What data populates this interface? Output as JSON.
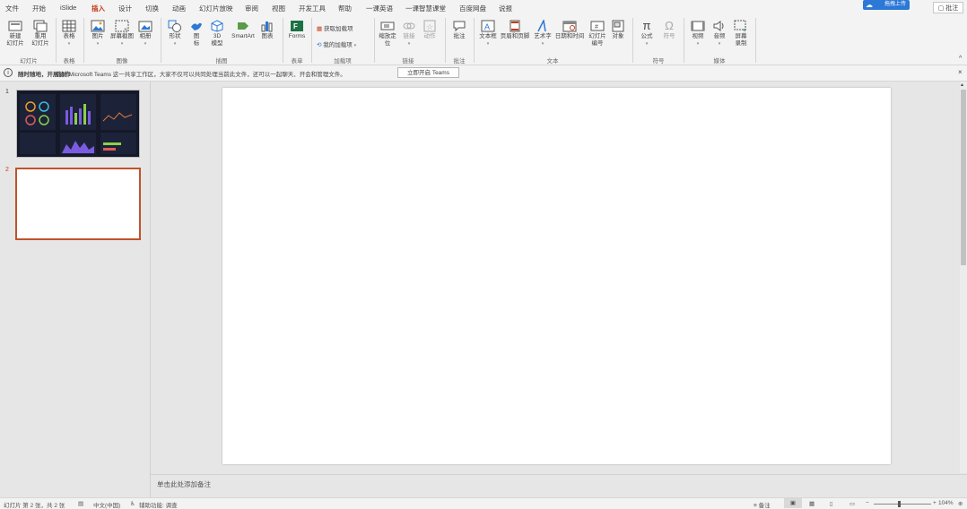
{
  "tabs": [
    "文件",
    "开始",
    "iSlide",
    "插入",
    "设计",
    "切换",
    "动画",
    "幻灯片放映",
    "审阅",
    "视图",
    "开发工具",
    "帮助",
    "一课英语",
    "一课智慧课堂",
    "百度网盘",
    "说报"
  ],
  "active_tab": "插入",
  "top_right": {
    "cloud_label": "拖拽上传",
    "comment_label": "批注"
  },
  "ribbon": {
    "new_slide": "新建\n幻灯片",
    "reuse_slide": "重用\n幻灯片",
    "table": "表格",
    "picture": "图片",
    "screenshot": "屏幕截图",
    "album": "相册",
    "shapes": "形状",
    "icons": "图\n标",
    "model3d": "3D\n模型",
    "smartart": "SmartArt",
    "chart": "图表",
    "forms": "Forms",
    "get_addins": "获取加载项",
    "my_addins": "我的加载项",
    "zoom": "缩放定\n位",
    "link": "链接",
    "action": "动作",
    "comment": "批注",
    "textbox": "文本框",
    "header_footer": "页眉和页脚",
    "wordart": "艺术字",
    "datetime": "日期和时间",
    "slide_number": "幻灯片\n编号",
    "object": "对象",
    "equation": "公式",
    "symbol": "符号",
    "video": "视频",
    "audio": "音频",
    "screen_record": "屏幕\n录制"
  },
  "groups": {
    "slides": "幻灯片",
    "tables": "表格",
    "images": "图像",
    "illustrations": "插图",
    "forms": "表单",
    "addins": "加载项",
    "links": "链接",
    "comments": "批注",
    "text": "文本",
    "symbols": "符号",
    "media": "媒体"
  },
  "infobar": {
    "bold": "随时随地，开展协作",
    "text": "借助 Microsoft Teams 这一共享工作区，大家不仅可以共同处理当前此文件，还可以一起聊天、开会和管理文件。",
    "button": "立即开启 Teams"
  },
  "thumbnails": [
    {
      "number": "1"
    },
    {
      "number": "2"
    }
  ],
  "notes_placeholder": "单击此处添加备注",
  "status": {
    "slide_info": "幻灯片 第 2 张，共 2 张",
    "language": "中文(中国)",
    "accessibility": "辅助功能: 调查",
    "notes_button": "备注",
    "zoom_level": "104%"
  },
  "colors": {
    "accent": "#c43e1c",
    "selected_thumb_border": "#c0522b",
    "cloud_badge": "#2b78d6"
  }
}
